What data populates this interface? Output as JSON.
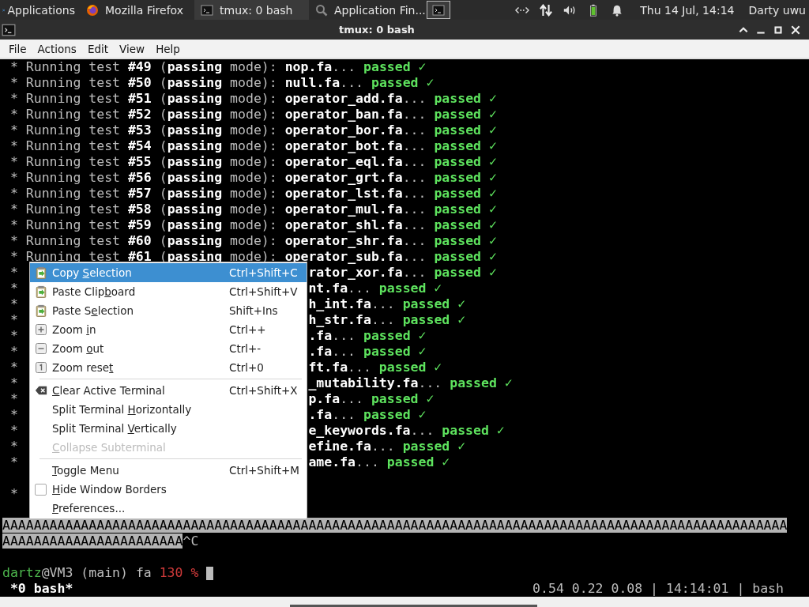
{
  "panel": {
    "apps_label": "Applications",
    "tasks": [
      {
        "label": "Mozilla Firefox",
        "kind": "firefox",
        "selected": false
      },
      {
        "label": "tmux: 0 bash",
        "kind": "terminal",
        "selected": true
      },
      {
        "label": "Application Fin...",
        "kind": "search",
        "selected": false
      }
    ],
    "clock": "Thu 14 Jul, 14:14",
    "user": "Darty uwu"
  },
  "window": {
    "title": "tmux: 0 bash"
  },
  "menubar": [
    "File",
    "Actions",
    "Edit",
    "View",
    "Help"
  ],
  "terminal": {
    "lines": [
      {
        "kind": "test",
        "segments": [
          {
            "kind": "dim",
            "text": "* Running test "
          },
          {
            "kind": "bold",
            "text": "#49"
          },
          {
            "kind": "dim",
            "text": " ("
          },
          {
            "kind": "bold",
            "text": "passing"
          },
          {
            "kind": "dim",
            "text": " mode): "
          },
          {
            "kind": "bold",
            "text": "nop.fa"
          },
          {
            "kind": "dim",
            "text": "... "
          },
          {
            "kind": "pass",
            "text": "passed"
          },
          {
            "kind": "check",
            "text": " ✓"
          }
        ]
      },
      {
        "kind": "test",
        "segments": [
          {
            "kind": "dim",
            "text": "* Running test "
          },
          {
            "kind": "bold",
            "text": "#50"
          },
          {
            "kind": "dim",
            "text": " ("
          },
          {
            "kind": "bold",
            "text": "passing"
          },
          {
            "kind": "dim",
            "text": " mode): "
          },
          {
            "kind": "bold",
            "text": "null.fa"
          },
          {
            "kind": "dim",
            "text": "... "
          },
          {
            "kind": "pass",
            "text": "passed"
          },
          {
            "kind": "check",
            "text": " ✓"
          }
        ]
      },
      {
        "kind": "test",
        "segments": [
          {
            "kind": "dim",
            "text": "* Running test "
          },
          {
            "kind": "bold",
            "text": "#51"
          },
          {
            "kind": "dim",
            "text": " ("
          },
          {
            "kind": "bold",
            "text": "passing"
          },
          {
            "kind": "dim",
            "text": " mode): "
          },
          {
            "kind": "bold",
            "text": "operator_add.fa"
          },
          {
            "kind": "dim",
            "text": "... "
          },
          {
            "kind": "pass",
            "text": "passed"
          },
          {
            "kind": "check",
            "text": " ✓"
          }
        ]
      },
      {
        "kind": "test",
        "segments": [
          {
            "kind": "dim",
            "text": "* Running test "
          },
          {
            "kind": "bold",
            "text": "#52"
          },
          {
            "kind": "dim",
            "text": " ("
          },
          {
            "kind": "bold",
            "text": "passing"
          },
          {
            "kind": "dim",
            "text": " mode): "
          },
          {
            "kind": "bold",
            "text": "operator_ban.fa"
          },
          {
            "kind": "dim",
            "text": "... "
          },
          {
            "kind": "pass",
            "text": "passed"
          },
          {
            "kind": "check",
            "text": " ✓"
          }
        ]
      },
      {
        "kind": "test",
        "segments": [
          {
            "kind": "dim",
            "text": "* Running test "
          },
          {
            "kind": "bold",
            "text": "#53"
          },
          {
            "kind": "dim",
            "text": " ("
          },
          {
            "kind": "bold",
            "text": "passing"
          },
          {
            "kind": "dim",
            "text": " mode): "
          },
          {
            "kind": "bold",
            "text": "operator_bor.fa"
          },
          {
            "kind": "dim",
            "text": "... "
          },
          {
            "kind": "pass",
            "text": "passed"
          },
          {
            "kind": "check",
            "text": " ✓"
          }
        ]
      },
      {
        "kind": "test",
        "segments": [
          {
            "kind": "dim",
            "text": "* Running test "
          },
          {
            "kind": "bold",
            "text": "#54"
          },
          {
            "kind": "dim",
            "text": " ("
          },
          {
            "kind": "bold",
            "text": "passing"
          },
          {
            "kind": "dim",
            "text": " mode): "
          },
          {
            "kind": "bold",
            "text": "operator_bot.fa"
          },
          {
            "kind": "dim",
            "text": "... "
          },
          {
            "kind": "pass",
            "text": "passed"
          },
          {
            "kind": "check",
            "text": " ✓"
          }
        ]
      },
      {
        "kind": "test",
        "segments": [
          {
            "kind": "dim",
            "text": "* Running test "
          },
          {
            "kind": "bold",
            "text": "#55"
          },
          {
            "kind": "dim",
            "text": " ("
          },
          {
            "kind": "bold",
            "text": "passing"
          },
          {
            "kind": "dim",
            "text": " mode): "
          },
          {
            "kind": "bold",
            "text": "operator_eql.fa"
          },
          {
            "kind": "dim",
            "text": "... "
          },
          {
            "kind": "pass",
            "text": "passed"
          },
          {
            "kind": "check",
            "text": " ✓"
          }
        ]
      },
      {
        "kind": "test",
        "segments": [
          {
            "kind": "dim",
            "text": "* Running test "
          },
          {
            "kind": "bold",
            "text": "#56"
          },
          {
            "kind": "dim",
            "text": " ("
          },
          {
            "kind": "bold",
            "text": "passing"
          },
          {
            "kind": "dim",
            "text": " mode): "
          },
          {
            "kind": "bold",
            "text": "operator_grt.fa"
          },
          {
            "kind": "dim",
            "text": "... "
          },
          {
            "kind": "pass",
            "text": "passed"
          },
          {
            "kind": "check",
            "text": " ✓"
          }
        ]
      },
      {
        "kind": "test",
        "segments": [
          {
            "kind": "dim",
            "text": "* Running test "
          },
          {
            "kind": "bold",
            "text": "#57"
          },
          {
            "kind": "dim",
            "text": " ("
          },
          {
            "kind": "bold",
            "text": "passing"
          },
          {
            "kind": "dim",
            "text": " mode): "
          },
          {
            "kind": "bold",
            "text": "operator_lst.fa"
          },
          {
            "kind": "dim",
            "text": "... "
          },
          {
            "kind": "pass",
            "text": "passed"
          },
          {
            "kind": "check",
            "text": " ✓"
          }
        ]
      },
      {
        "kind": "test",
        "segments": [
          {
            "kind": "dim",
            "text": "* Running test "
          },
          {
            "kind": "bold",
            "text": "#58"
          },
          {
            "kind": "dim",
            "text": " ("
          },
          {
            "kind": "bold",
            "text": "passing"
          },
          {
            "kind": "dim",
            "text": " mode): "
          },
          {
            "kind": "bold",
            "text": "operator_mul.fa"
          },
          {
            "kind": "dim",
            "text": "... "
          },
          {
            "kind": "pass",
            "text": "passed"
          },
          {
            "kind": "check",
            "text": " ✓"
          }
        ]
      },
      {
        "kind": "test",
        "segments": [
          {
            "kind": "dim",
            "text": "* Running test "
          },
          {
            "kind": "bold",
            "text": "#59"
          },
          {
            "kind": "dim",
            "text": " ("
          },
          {
            "kind": "bold",
            "text": "passing"
          },
          {
            "kind": "dim",
            "text": " mode): "
          },
          {
            "kind": "bold",
            "text": "operator_shl.fa"
          },
          {
            "kind": "dim",
            "text": "... "
          },
          {
            "kind": "pass",
            "text": "passed"
          },
          {
            "kind": "check",
            "text": " ✓"
          }
        ]
      },
      {
        "kind": "test",
        "segments": [
          {
            "kind": "dim",
            "text": "* Running test "
          },
          {
            "kind": "bold",
            "text": "#60"
          },
          {
            "kind": "dim",
            "text": " ("
          },
          {
            "kind": "bold",
            "text": "passing"
          },
          {
            "kind": "dim",
            "text": " mode): "
          },
          {
            "kind": "bold",
            "text": "operator_shr.fa"
          },
          {
            "kind": "dim",
            "text": "... "
          },
          {
            "kind": "pass",
            "text": "passed"
          },
          {
            "kind": "check",
            "text": " ✓"
          }
        ]
      },
      {
        "kind": "test",
        "segments": [
          {
            "kind": "dim",
            "text": "* Running test "
          },
          {
            "kind": "bold",
            "text": "#61"
          },
          {
            "kind": "dim",
            "text": " ("
          },
          {
            "kind": "bold",
            "text": "passing"
          },
          {
            "kind": "dim",
            "text": " mode): "
          },
          {
            "kind": "bold",
            "text": "operator_sub.fa"
          },
          {
            "kind": "dim",
            "text": "... "
          },
          {
            "kind": "pass",
            "text": "passed"
          },
          {
            "kind": "check",
            "text": " ✓"
          }
        ]
      },
      {
        "kind": "covered",
        "head": "*",
        "segments": [
          {
            "kind": "bold",
            "text": "rator_xor.fa"
          },
          {
            "kind": "dim",
            "text": "... "
          },
          {
            "kind": "pass",
            "text": "passed"
          },
          {
            "kind": "check",
            "text": " ✓"
          }
        ]
      },
      {
        "kind": "covered",
        "head": "*",
        "segments": [
          {
            "kind": "bold",
            "text": "nt.fa"
          },
          {
            "kind": "dim",
            "text": "... "
          },
          {
            "kind": "pass",
            "text": "passed"
          },
          {
            "kind": "check",
            "text": " ✓"
          }
        ]
      },
      {
        "kind": "covered",
        "head": "*",
        "segments": [
          {
            "kind": "bold",
            "text": "h_int.fa"
          },
          {
            "kind": "dim",
            "text": "... "
          },
          {
            "kind": "pass",
            "text": "passed"
          },
          {
            "kind": "check",
            "text": " ✓"
          }
        ]
      },
      {
        "kind": "covered",
        "head": "*",
        "segments": [
          {
            "kind": "bold",
            "text": "h_str.fa"
          },
          {
            "kind": "dim",
            "text": "... "
          },
          {
            "kind": "pass",
            "text": "passed"
          },
          {
            "kind": "check",
            "text": " ✓"
          }
        ]
      },
      {
        "kind": "covered",
        "head": "*",
        "segments": [
          {
            "kind": "bold",
            "text": ".fa"
          },
          {
            "kind": "dim",
            "text": "... "
          },
          {
            "kind": "pass",
            "text": "passed"
          },
          {
            "kind": "check",
            "text": " ✓"
          }
        ]
      },
      {
        "kind": "covered",
        "head": "*",
        "segments": [
          {
            "kind": "bold",
            "text": ".fa"
          },
          {
            "kind": "dim",
            "text": "... "
          },
          {
            "kind": "pass",
            "text": "passed"
          },
          {
            "kind": "check",
            "text": " ✓"
          }
        ]
      },
      {
        "kind": "covered",
        "head": "*",
        "segments": [
          {
            "kind": "bold",
            "text": "ft.fa"
          },
          {
            "kind": "dim",
            "text": "... "
          },
          {
            "kind": "pass",
            "text": "passed"
          },
          {
            "kind": "check",
            "text": " ✓"
          }
        ]
      },
      {
        "kind": "covered",
        "head": "*",
        "segments": [
          {
            "kind": "bold",
            "text": "_mutability.fa"
          },
          {
            "kind": "dim",
            "text": "... "
          },
          {
            "kind": "pass",
            "text": "passed"
          },
          {
            "kind": "check",
            "text": " ✓"
          }
        ]
      },
      {
        "kind": "covered",
        "head": "*",
        "segments": [
          {
            "kind": "bold",
            "text": "p.fa"
          },
          {
            "kind": "dim",
            "text": "... "
          },
          {
            "kind": "pass",
            "text": "passed"
          },
          {
            "kind": "check",
            "text": " ✓"
          }
        ]
      },
      {
        "kind": "covered",
        "head": "*",
        "segments": [
          {
            "kind": "bold",
            "text": ".fa"
          },
          {
            "kind": "dim",
            "text": "... "
          },
          {
            "kind": "pass",
            "text": "passed"
          },
          {
            "kind": "check",
            "text": " ✓"
          }
        ]
      },
      {
        "kind": "covered",
        "head": "*",
        "segments": [
          {
            "kind": "bold",
            "text": "e_keywords.fa"
          },
          {
            "kind": "dim",
            "text": "... "
          },
          {
            "kind": "pass",
            "text": "passed"
          },
          {
            "kind": "check",
            "text": " ✓"
          }
        ]
      },
      {
        "kind": "covered",
        "head": "*",
        "segments": [
          {
            "kind": "bold",
            "text": "efine.fa"
          },
          {
            "kind": "dim",
            "text": "... "
          },
          {
            "kind": "pass",
            "text": "passed"
          },
          {
            "kind": "check",
            "text": " ✓"
          }
        ]
      },
      {
        "kind": "covered",
        "head": "*",
        "segments": [
          {
            "kind": "bold",
            "text": "ame.fa"
          },
          {
            "kind": "dim",
            "text": "... "
          },
          {
            "kind": "pass",
            "text": "passed"
          },
          {
            "kind": "check",
            "text": " ✓"
          }
        ]
      },
      {
        "kind": "blank"
      },
      {
        "kind": "covered",
        "head": "*"
      },
      {
        "kind": "blank"
      },
      {
        "kind": "output",
        "segments": [
          {
            "kind": "selected",
            "text": "AAAAAAAAAAAAAAAAAAAAAAAAAAAAAAAAAAAAAAAAAAAAAAAAAAAAAAAAAAAAAAAAAAAAAAAAAAAAAAAAAAAAAAAAAAAAAAAAAAAA"
          }
        ]
      },
      {
        "kind": "output",
        "segments": [
          {
            "kind": "selected",
            "text": "AAAAAAAAAAAAAAAAAAAAAAA"
          },
          {
            "kind": "dim",
            "text": "^C"
          }
        ]
      },
      {
        "kind": "blank"
      },
      {
        "kind": "prompt",
        "segments": [
          {
            "kind": "user",
            "text": "dartz"
          },
          {
            "kind": "dim",
            "text": "@VM3 (main) fa "
          },
          {
            "kind": "error",
            "text": "130 %"
          }
        ]
      }
    ],
    "status_bar": {
      "window": "*0 bash*",
      "info": "0.54 0.22 0.08 | 14:14:01 | bash"
    }
  },
  "context_menu": [
    {
      "kind": "copy",
      "before": "Copy ",
      "key": "S",
      "after": "election",
      "shortcut": "Ctrl+Shift+C",
      "selected": true,
      "disabled": false
    },
    {
      "kind": "paste",
      "before": "Paste Clip",
      "key": "b",
      "after": "oard",
      "shortcut": "Ctrl+Shift+V",
      "selected": false,
      "disabled": false
    },
    {
      "kind": "paste",
      "before": "Paste S",
      "key": "e",
      "after": "lection",
      "shortcut": "Shift+Ins",
      "selected": false,
      "disabled": false
    },
    {
      "kind": "zoom-in",
      "before": "Zoom ",
      "key": "i",
      "after": "n",
      "shortcut": "Ctrl++",
      "selected": false,
      "disabled": false
    },
    {
      "kind": "zoom-out",
      "before": "Zoom ",
      "key": "o",
      "after": "ut",
      "shortcut": "Ctrl+-",
      "selected": false,
      "disabled": false
    },
    {
      "kind": "zoom-reset",
      "before": "Zoom rese",
      "key": "t",
      "shortcut": "Ctrl+0",
      "selected": false,
      "disabled": false
    },
    {
      "kind": "separator"
    },
    {
      "kind": "clear",
      "key": "C",
      "after": "lear Active Terminal",
      "shortcut": "Ctrl+Shift+X",
      "selected": false,
      "disabled": false
    },
    {
      "kind": "plain",
      "before": "Split Terminal ",
      "key": "H",
      "after": "orizontally",
      "selected": false,
      "disabled": false
    },
    {
      "kind": "plain",
      "before": "Split Terminal ",
      "key": "V",
      "after": "ertically",
      "selected": false,
      "disabled": false
    },
    {
      "kind": "plain",
      "key": "C",
      "after": "ollapse Subterminal",
      "selected": false,
      "disabled": true
    },
    {
      "kind": "separator"
    },
    {
      "kind": "plain",
      "key": "T",
      "after": "oggle Menu",
      "shortcut": "Ctrl+Shift+M",
      "selected": false,
      "disabled": false
    },
    {
      "kind": "checkbox",
      "key": "H",
      "after": "ide Window Borders",
      "checked": false,
      "selected": false,
      "disabled": false
    },
    {
      "kind": "plain",
      "key": "P",
      "after": "references...",
      "selected": false,
      "disabled": false
    }
  ]
}
